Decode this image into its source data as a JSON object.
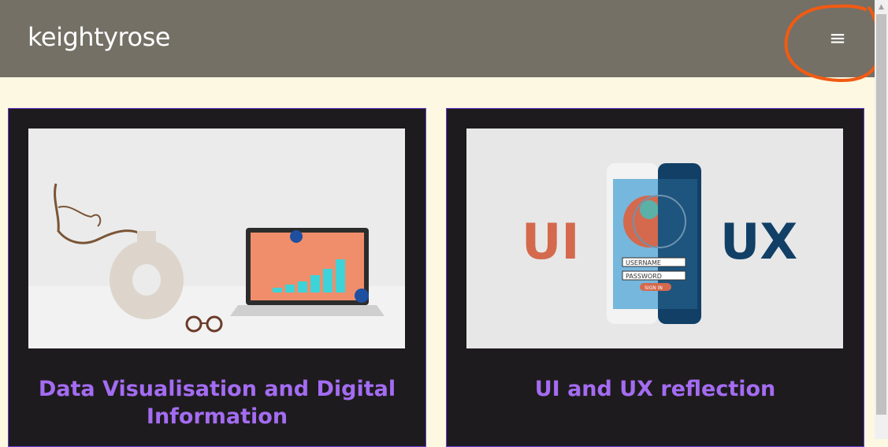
{
  "header": {
    "brand": "keightyrose",
    "menu_icon": "hamburger-menu-icon",
    "menu_glyph": "≡",
    "background_color": "#747066",
    "annotation_color": "#f25a12"
  },
  "page": {
    "background_color": "#fdf8e1"
  },
  "cards": [
    {
      "title": "Data Visualisation and Digital Information",
      "image": "laptop-chart-vase-glasses-image"
    },
    {
      "title": "UI and UX reflection",
      "image": "ui-ux-phone-illustration-image",
      "image_text": {
        "left": "UI",
        "right": "UX",
        "username": "USERNAME",
        "password": "PASSWORD",
        "button": "SIGN IN"
      }
    }
  ],
  "colors": {
    "card_bg": "#1e1b1e",
    "card_border": "#6b3fd1",
    "title": "#a46cf2"
  }
}
